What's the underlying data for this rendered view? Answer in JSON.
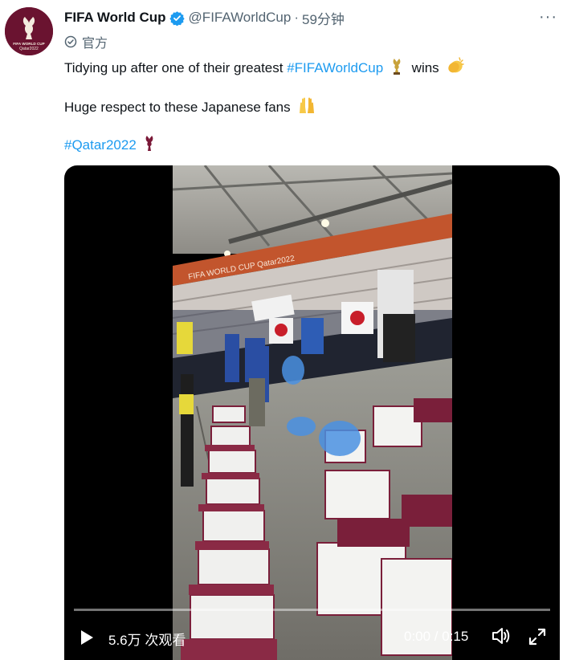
{
  "author": {
    "display_name": "FIFA World Cup",
    "handle": "@FIFAWorldCup",
    "separator": "·",
    "time": "59分钟",
    "official_label": "官方",
    "avatar_text": [
      "FIFA WORLD CUP",
      "Qatar2022"
    ]
  },
  "more_label": "···",
  "tweet": {
    "line1_text": "Tidying up after one of their greatest ",
    "line1_hashtag": "#FIFAWorldCup",
    "line1_end": "wins",
    "line2_text": "Huge respect to these Japanese fans",
    "line3_hashtag": "#Qatar2022"
  },
  "stadium_banner_text": "FIFA WORLD CUP Qatar2022",
  "video": {
    "views_label": "5.6万 次观看",
    "duration_label": "0:00 / 0:15",
    "progress": 0
  },
  "colors": {
    "link": "#1d9bf0",
    "verified": "#1d9bf0",
    "brand": "#6a1330"
  },
  "icons": [
    "verified-badge-icon",
    "official-badge-icon",
    "more-icon",
    "trophy-icon",
    "clapping-hands-icon",
    "raising-hands-icon",
    "trophy-emblem-icon",
    "play-icon",
    "volume-icon",
    "fullscreen-icon"
  ]
}
